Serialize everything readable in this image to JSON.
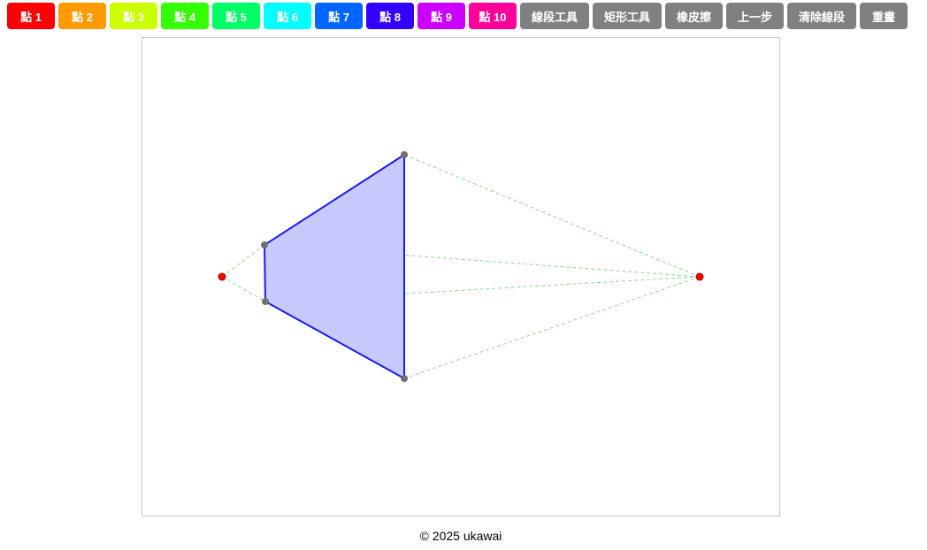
{
  "point_buttons": [
    {
      "label": "點 1",
      "color": "#ff0000"
    },
    {
      "label": "點 2",
      "color": "#ff9900"
    },
    {
      "label": "點 3",
      "color": "#ccff00"
    },
    {
      "label": "點 4",
      "color": "#33ff00"
    },
    {
      "label": "點 5",
      "color": "#00ff66"
    },
    {
      "label": "點 6",
      "color": "#00ffff"
    },
    {
      "label": "點 7",
      "color": "#0066ff"
    },
    {
      "label": "點 8",
      "color": "#3300ff"
    },
    {
      "label": "點 9",
      "color": "#cc00ff"
    },
    {
      "label": "點 10",
      "color": "#ff0099"
    }
  ],
  "tools": {
    "line_tool": "線段工具",
    "rect_tool": "矩形工具",
    "eraser": "橡皮擦",
    "undo": "上一步",
    "clear_lines": "清除線段",
    "redraw": "重畫"
  },
  "footer": {
    "copyright": "© 2025 ukawai"
  },
  "colors": {
    "tool_button": "#808080",
    "shape_fill": "#c8caff",
    "shape_stroke": "#1a1aff",
    "guide_line": "#88dd88",
    "vanishing_point": "#ff0000",
    "vertex": "#707070"
  }
}
